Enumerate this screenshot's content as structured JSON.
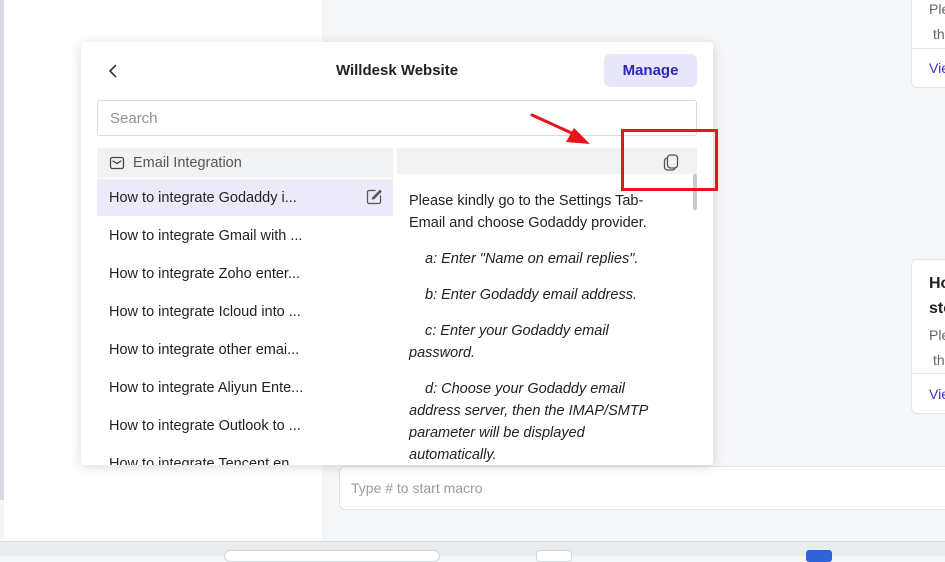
{
  "popup": {
    "title": "Willdesk Website",
    "manage_label": "Manage",
    "search_placeholder": "Search"
  },
  "list": {
    "group_label": "Email Integration",
    "items": [
      {
        "label": "How to integrate Godaddy i..."
      },
      {
        "label": "How to integrate Gmail with ..."
      },
      {
        "label": "How to integrate Zoho enter..."
      },
      {
        "label": "How to integrate Icloud into ..."
      },
      {
        "label": "How to integrate other emai..."
      },
      {
        "label": "How to integrate Aliyun Ente..."
      },
      {
        "label": "How to integrate Outlook to ..."
      },
      {
        "label": "How to integrate Tencent en..."
      }
    ]
  },
  "preview": {
    "paragraphs": [
      "Please kindly go to the Settings Tab-Email and choose Godaddy provider.",
      "a: Enter \"Name on email replies\".",
      "b: Enter Godaddy email address.",
      "c: Enter your Godaddy email password.",
      "d: Choose your Godaddy email address server, then the IMAP/SMTP parameter will be displayed automatically."
    ]
  },
  "macro": {
    "placeholder": "Type # to start macro"
  },
  "cards": [
    {
      "snippet_1": "Ple",
      "snippet_2": "th",
      "view": "Vie"
    },
    {
      "title_1": "Ho",
      "title_2": "sto",
      "snippet_1": "Ple",
      "snippet_2": "th",
      "view": "Vie"
    }
  ],
  "colors": {
    "accent": "#2d25b8",
    "accent_bg": "#e7e6fb",
    "annotation": "#e8141c"
  }
}
